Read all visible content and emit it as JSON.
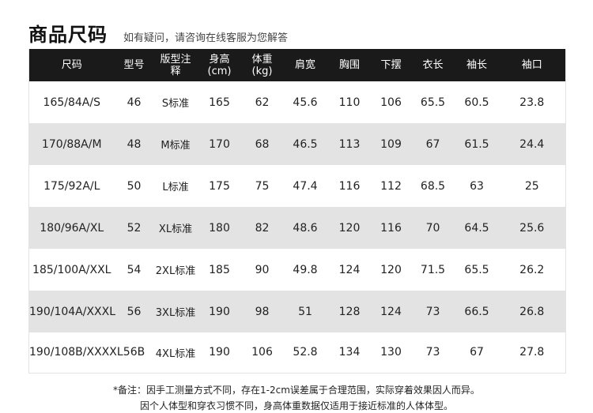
{
  "header": {
    "title": "商品尺码",
    "subtitle": "如有疑问，请咨询在线客服为您解答"
  },
  "table": {
    "columns": [
      {
        "line1": "尺码",
        "line2": ""
      },
      {
        "line1": "型号",
        "line2": ""
      },
      {
        "line1": "版型注",
        "line2": "释"
      },
      {
        "line1": "身高",
        "line2": "(cm)"
      },
      {
        "line1": "体重",
        "line2": "(kg)"
      },
      {
        "line1": "肩宽",
        "line2": ""
      },
      {
        "line1": "胸围",
        "line2": ""
      },
      {
        "line1": "下摆",
        "line2": ""
      },
      {
        "line1": "衣长",
        "line2": ""
      },
      {
        "line1": "袖长",
        "line2": ""
      },
      {
        "line1": "袖口",
        "line2": ""
      }
    ],
    "rows": [
      [
        "165/84A/S",
        "46",
        "S标准",
        "165",
        "62",
        "45.6",
        "110",
        "106",
        "65.5",
        "60.5",
        "23.8"
      ],
      [
        "170/88A/M",
        "48",
        "M标准",
        "170",
        "68",
        "46.5",
        "113",
        "109",
        "67",
        "61.5",
        "24.4"
      ],
      [
        "175/92A/L",
        "50",
        "L标准",
        "175",
        "75",
        "47.4",
        "116",
        "112",
        "68.5",
        "63",
        "25"
      ],
      [
        "180/96A/XL",
        "52",
        "XL标准",
        "180",
        "82",
        "48.6",
        "120",
        "116",
        "70",
        "64.5",
        "25.6"
      ],
      [
        "185/100A/XXL",
        "54",
        "2XL标准",
        "185",
        "90",
        "49.8",
        "124",
        "120",
        "71.5",
        "65.5",
        "26.2"
      ],
      [
        "190/104A/XXXL",
        "56",
        "3XL标准",
        "190",
        "98",
        "51",
        "128",
        "124",
        "73",
        "66.5",
        "26.8"
      ],
      [
        "190/108B/XXXXL",
        "56B",
        "4XL标准",
        "190",
        "106",
        "52.8",
        "134",
        "130",
        "73",
        "67",
        "27.8"
      ]
    ]
  },
  "footnote": {
    "line1": "*备注：因手工测量方式不同，存在1-2cm误差属于合理范围，实际穿着效果因人而异。",
    "line2": "因个人体型和穿衣习惯不同，身高体重数据仅适用于接近标准的人体体型。"
  }
}
